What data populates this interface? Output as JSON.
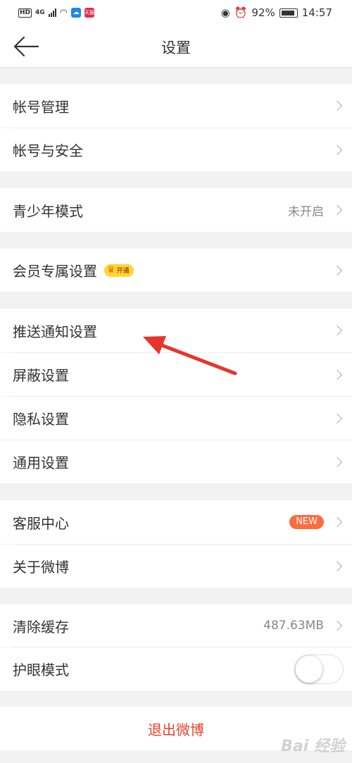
{
  "status_bar": {
    "network": "HD",
    "signal": "4G",
    "battery": "92%",
    "time": "14:57",
    "app_badge": "天猫"
  },
  "nav": {
    "title": "设置"
  },
  "groups": {
    "account": {
      "manage": "帐号管理",
      "security": "帐号与安全"
    },
    "teen": {
      "label": "青少年模式",
      "value": "未开启"
    },
    "vip": {
      "label": "会员专属设置",
      "badge": "开通"
    },
    "settings": {
      "push": "推送通知设置",
      "block": "屏蔽设置",
      "privacy": "隐私设置",
      "general": "通用设置"
    },
    "support": {
      "service": "客服中心",
      "new_badge": "NEW",
      "about": "关于微博"
    },
    "storage": {
      "cache_label": "清除缓存",
      "cache_value": "487.63MB",
      "eye_label": "护眼模式",
      "eye_enabled": false
    }
  },
  "logout": {
    "label": "退出微博"
  },
  "watermark": "Bai 经验",
  "colors": {
    "accent": "#e8412c",
    "annotation_arrow": "#e8352c",
    "new_badge": "#ff6b3d",
    "vip_badge": "#ffd633"
  }
}
